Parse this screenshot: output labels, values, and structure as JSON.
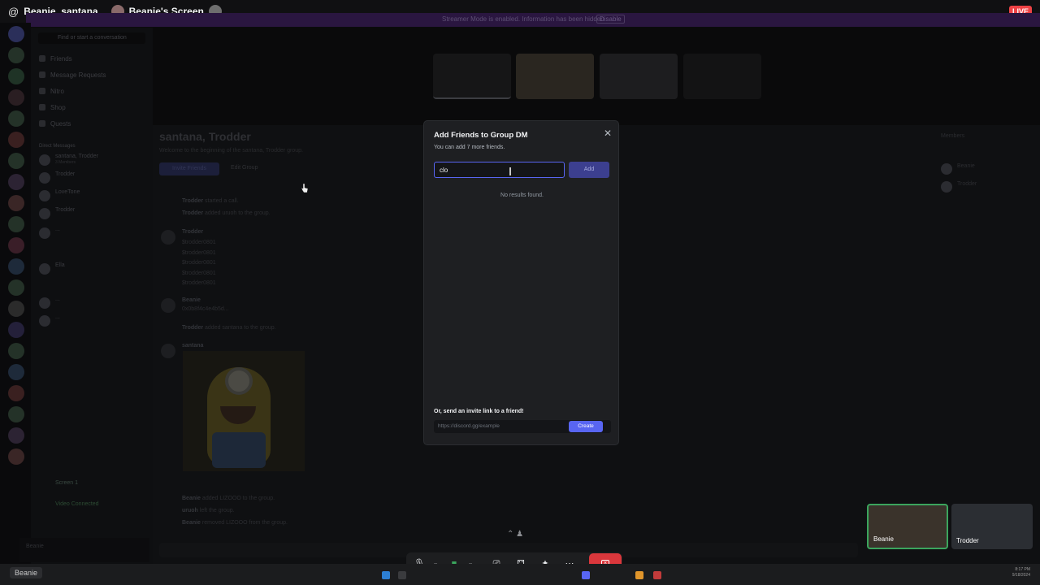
{
  "topbar": {
    "at_symbol": "@",
    "dm_title": "Beanie, santana",
    "screen_title": "Beanie's Screen",
    "live_badge": "LIVE"
  },
  "notice": {
    "text": "Streamer Mode is enabled. Information has been hidden.",
    "action": "Disable"
  },
  "sidebar": {
    "find_placeholder": "Find or start a conversation",
    "nav": [
      "Friends",
      "Message Requests",
      "Nitro",
      "Shop",
      "Quests"
    ],
    "shop_badge": "NEW",
    "dm_header": "Direct Messages",
    "dms": [
      {
        "name": "santana, Trodder",
        "sub": "3 Members"
      },
      {
        "name": "Trodder",
        "sub": ""
      },
      {
        "name": "LoveTone",
        "sub": ""
      },
      {
        "name": "Trodder",
        "sub": ""
      },
      {
        "name": "...",
        "sub": ""
      },
      {
        "name": "Ella",
        "sub": ""
      },
      {
        "name": "...",
        "sub": ""
      },
      {
        "name": "...",
        "sub": ""
      }
    ],
    "screen_item": "Screen 1",
    "voice_status": "Video Connected",
    "user_name": "Beanie"
  },
  "chat": {
    "title": "santana, Trodder",
    "subtitle": "Welcome to the beginning of the santana, Trodder group.",
    "invite_button": "Invite Friends",
    "edit_group": "Edit Group",
    "messages": [
      {
        "author": "Trodder",
        "text": "started a call."
      },
      {
        "author": "Trodder",
        "text": "added uruoh to the group."
      },
      {
        "author": "Trodder",
        "text": "$trodder0801"
      },
      {
        "author": "Beanie",
        "text": "0x0b8f4c4e4b5d..."
      },
      {
        "author": "Trodder",
        "text": "added santana to the group."
      },
      {
        "author": "santana",
        "text": ""
      },
      {
        "author": "Beanie",
        "text": "added LIZOOO to the group."
      },
      {
        "author": "uruoh",
        "text": "left the group."
      },
      {
        "author": "Beanie",
        "text": "removed LIZOOO from the group."
      }
    ]
  },
  "members": {
    "header": "Members",
    "list": [
      "Beanie",
      "Trodder"
    ]
  },
  "modal": {
    "title": "Add Friends to Group DM",
    "subtitle": "You can add 7 more friends.",
    "search_value": "clo",
    "add_button": "Add",
    "no_results": "No results found.",
    "invite_heading": "Or, send an invite link to a friend!",
    "invite_link": "https://discord.gg/example",
    "create_button": "Create"
  },
  "callbar": {
    "icons": [
      "microphone-icon",
      "camera-icon",
      "screen-share-icon",
      "activities-icon",
      "soundboard-icon",
      "more-icon",
      "end-call-icon"
    ]
  },
  "tiles": [
    {
      "name": "Beanie"
    },
    {
      "name": "Trodder"
    }
  ],
  "taskbar": {
    "label": "Beanie",
    "time": "8:17 PM",
    "date": "9/18/2024"
  },
  "colors": {
    "accent": "#5865f2",
    "live": "#ed4245",
    "end_call": "#da373c",
    "modal_bg": "#1e1f22"
  }
}
